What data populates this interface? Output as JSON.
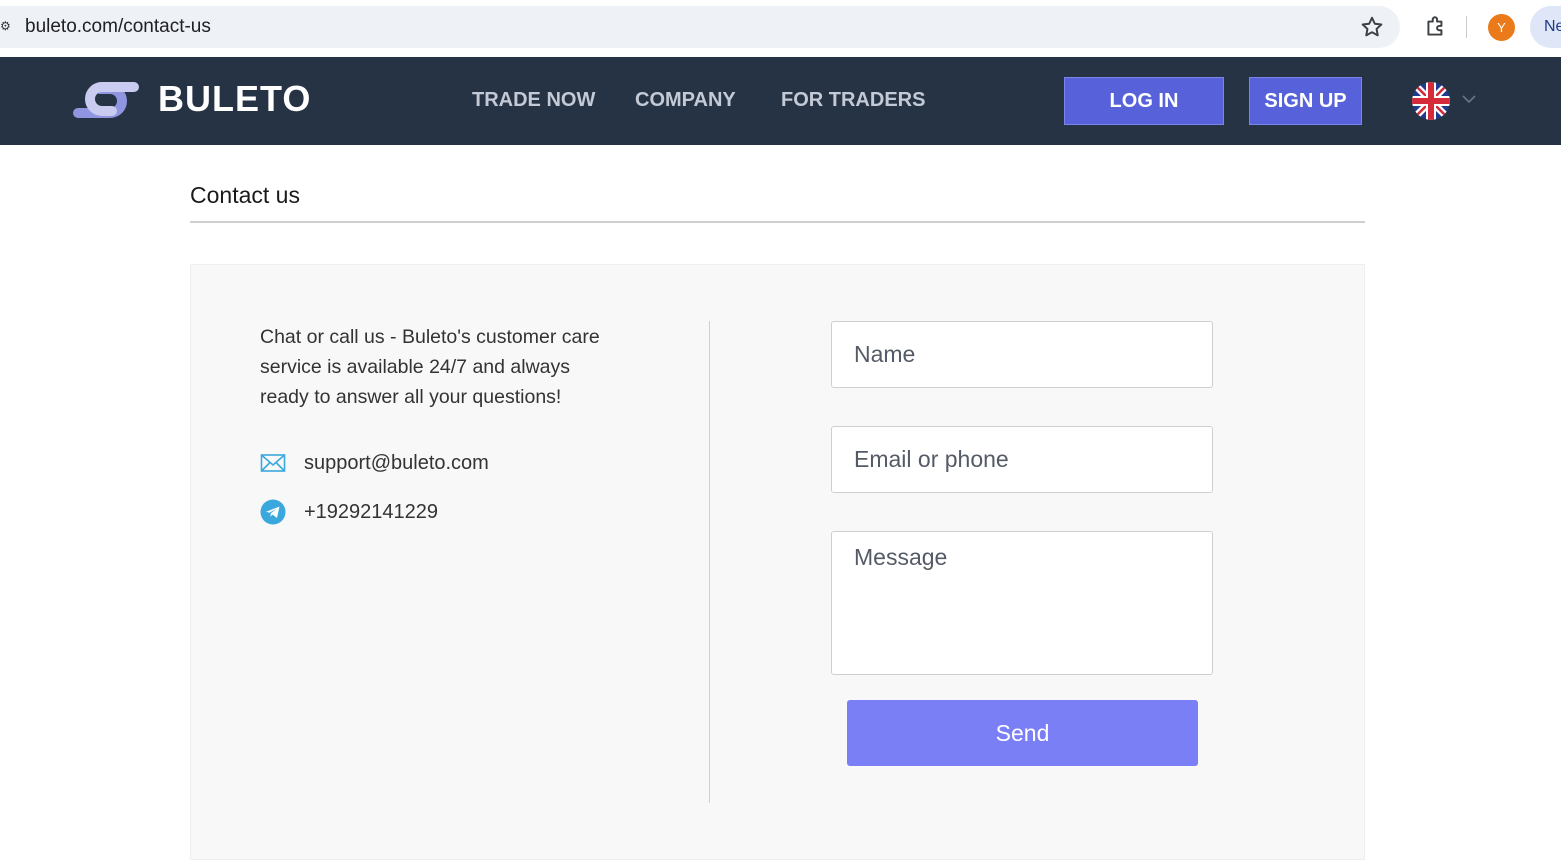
{
  "browser": {
    "url": "buleto.com/contact-us",
    "profile_initial": "Y",
    "new_chip_label": "Ne"
  },
  "header": {
    "logo_text": "BULETO",
    "nav": [
      {
        "label": "TRADE NOW"
      },
      {
        "label": "COMPANY"
      },
      {
        "label": "FOR TRADERS"
      }
    ],
    "login_label": "LOG IN",
    "signup_label": "SIGN UP",
    "language_icon": "uk-flag-icon"
  },
  "page": {
    "title": "Contact us",
    "intro": "Chat or call us - Buleto's customer care service is available 24/7 and always ready to answer all your questions!",
    "email": "support@buleto.com",
    "phone": "+19292141229"
  },
  "form": {
    "name_placeholder": "Name",
    "email_placeholder": "Email or phone",
    "message_placeholder": "Message",
    "send_label": "Send"
  },
  "colors": {
    "header_bg": "#263345",
    "button_primary": "#5761d9",
    "send_button": "#7b7ff5",
    "card_bg": "#f8f8f8"
  }
}
